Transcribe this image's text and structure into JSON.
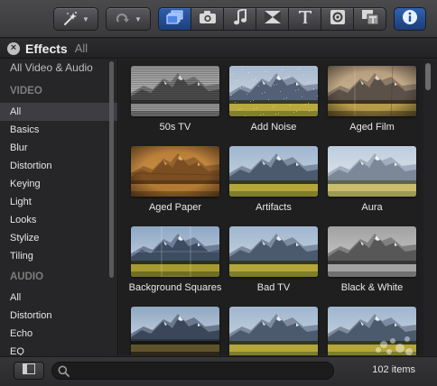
{
  "toolbar": {
    "buttons": [
      {
        "name": "magic-wand-icon"
      },
      {
        "name": "redo-icon"
      }
    ],
    "browser_tabs": [
      {
        "name": "clips-icon",
        "active": true
      },
      {
        "name": "camera-icon",
        "active": false
      },
      {
        "name": "music-note-icon",
        "active": false
      },
      {
        "name": "transitions-icon",
        "active": false
      },
      {
        "name": "title-text-icon",
        "active": false
      },
      {
        "name": "map-globe-icon",
        "active": false
      },
      {
        "name": "generators-icon",
        "active": false
      }
    ],
    "info_icon": "info-icon"
  },
  "header": {
    "title": "Effects",
    "breadcrumb": "All"
  },
  "sidebar": {
    "top": "All Video & Audio",
    "video_heading": "VIDEO",
    "video_items": [
      "All",
      "Basics",
      "Blur",
      "Distortion",
      "Keying",
      "Light",
      "Looks",
      "Stylize",
      "Tiling"
    ],
    "selected": "All",
    "audio_heading": "AUDIO",
    "audio_items": [
      "All",
      "Distortion",
      "Echo",
      "EQ"
    ]
  },
  "effects": [
    {
      "label": "50s TV",
      "style": "bw"
    },
    {
      "label": "Add Noise",
      "style": "noise"
    },
    {
      "label": "Aged Film",
      "style": "agedfilm"
    },
    {
      "label": "Aged Paper",
      "style": "sepia"
    },
    {
      "label": "Artifacts",
      "style": "normal"
    },
    {
      "label": "Aura",
      "style": "aura"
    },
    {
      "label": "Background Squares",
      "style": "squares"
    },
    {
      "label": "Bad TV",
      "style": "normal"
    },
    {
      "label": "Black & White",
      "style": "gray"
    },
    {
      "label": "",
      "style": "dark"
    },
    {
      "label": "",
      "style": "normal"
    },
    {
      "label": "",
      "style": "bokeh"
    }
  ],
  "bottom": {
    "search_placeholder": "",
    "count": "102 items"
  },
  "colors": {
    "accent_blue": "#2a5aa8",
    "sidebar_bg": "#262628",
    "grid_bg": "#1f1f20"
  }
}
